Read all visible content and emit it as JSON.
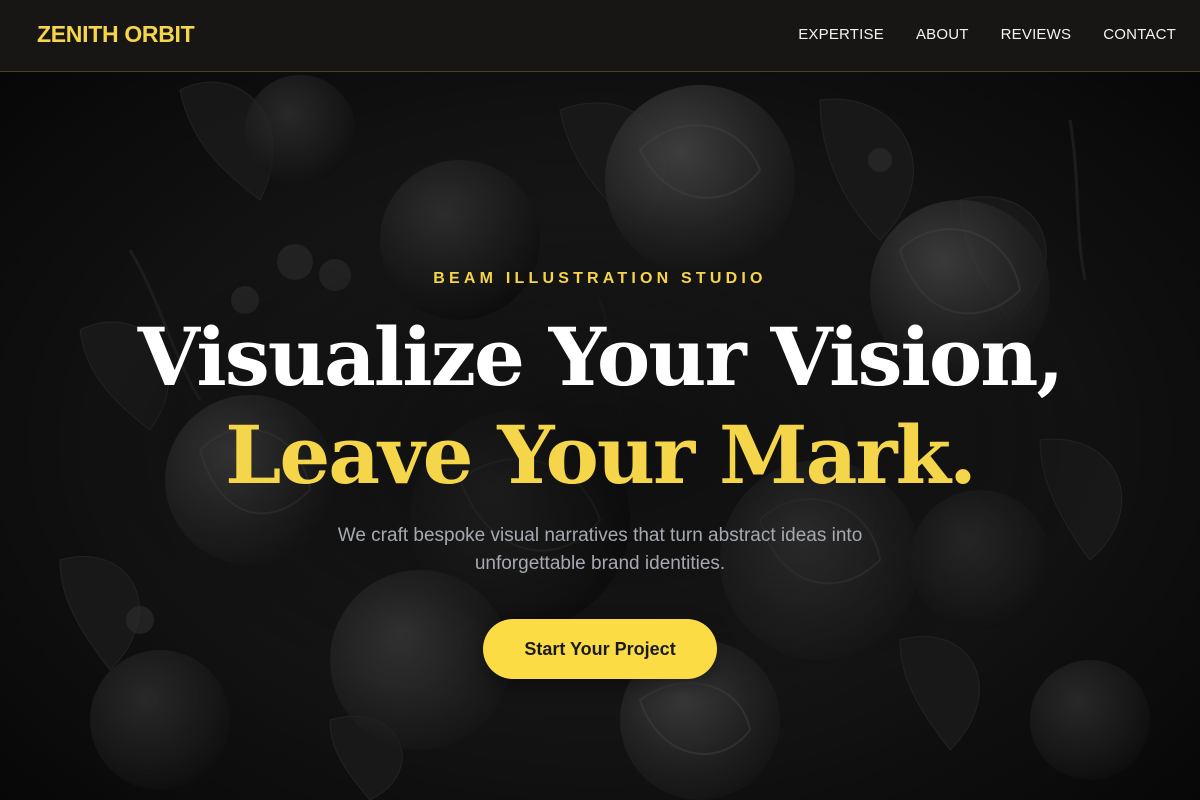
{
  "nav": {
    "brand": "ZENITH ORBIT",
    "links": [
      "EXPERTISE",
      "ABOUT",
      "REVIEWS",
      "CONTACT"
    ]
  },
  "hero": {
    "kicker": "BEAM ILLUSTRATION STUDIO",
    "headline_line1": "Visualize Your Vision,",
    "headline_line2": "Leave Your Mark.",
    "subtitle": "We craft bespoke visual narratives that turn abstract ideas into unforgettable brand identities.",
    "cta_label": "Start Your Project",
    "background": "dark monochrome floral still-life painting"
  },
  "colors": {
    "accent": "#f5d54a",
    "nav_bg": "#191715",
    "text_primary": "#ffffff",
    "text_muted": "#a6a9b2",
    "cta_bg": "#fbdc45"
  }
}
